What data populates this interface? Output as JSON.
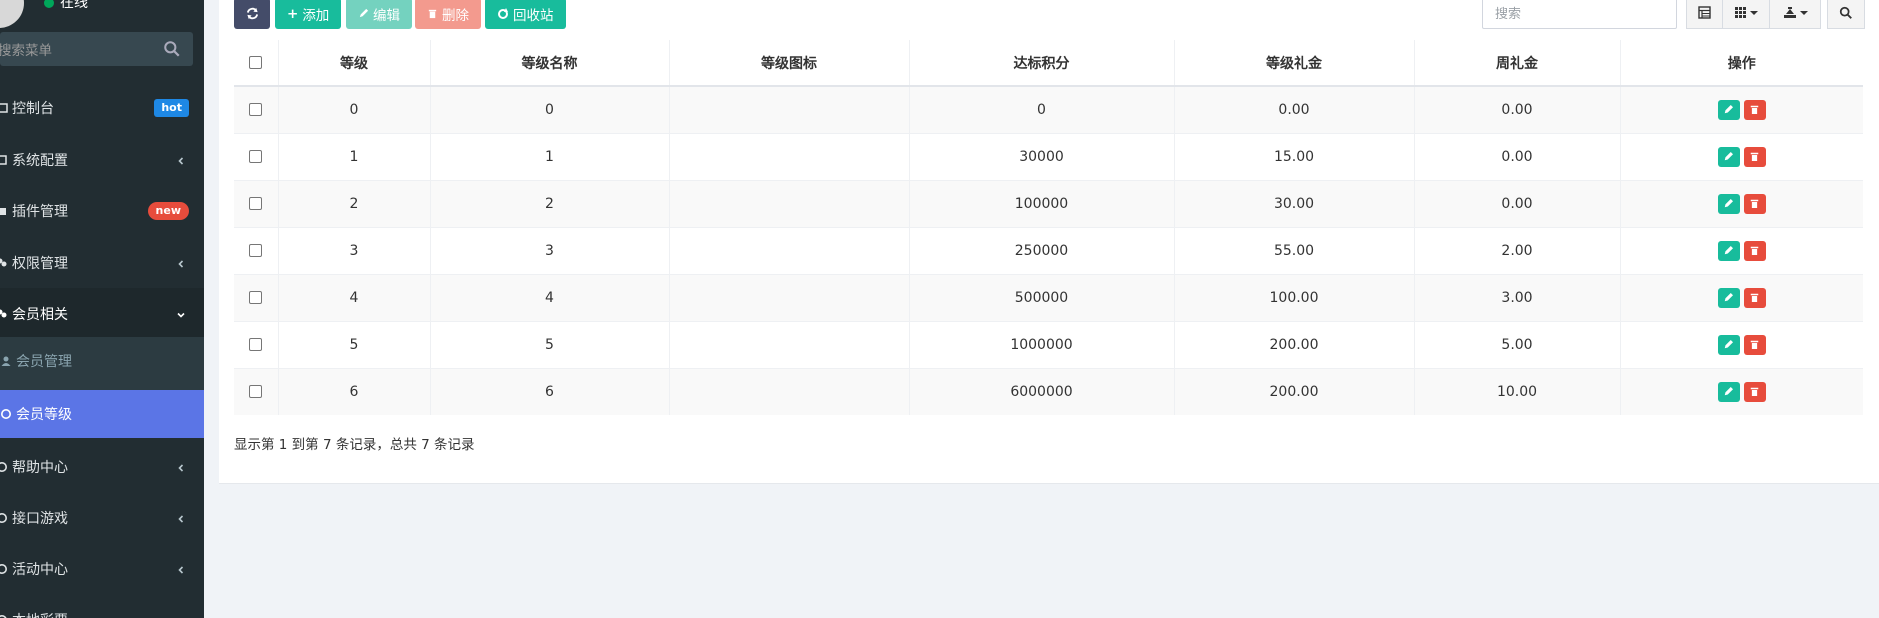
{
  "user": {
    "status": "在线"
  },
  "sidebar": {
    "search_placeholder": "搜索菜单",
    "items": [
      {
        "label": "控制台",
        "badge": "hot"
      },
      {
        "label": "系统配置"
      },
      {
        "label": "插件管理",
        "badge": "new"
      },
      {
        "label": "权限管理"
      },
      {
        "label": "会员相关"
      },
      {
        "label": "帮助中心"
      },
      {
        "label": "接口游戏"
      },
      {
        "label": "活动中心"
      },
      {
        "label": "本地彩票"
      }
    ],
    "submenu": [
      {
        "label": "会员管理"
      },
      {
        "label": "会员等级"
      }
    ]
  },
  "toolbar": {
    "add": "添加",
    "edit": "编辑",
    "delete": "删除",
    "recycle": "回收站",
    "search_placeholder": "搜索"
  },
  "table": {
    "columns": [
      "等级",
      "等级名称",
      "等级图标",
      "达标积分",
      "等级礼金",
      "周礼金",
      "操作"
    ],
    "rows": [
      {
        "level": "0",
        "name": "0",
        "icon": "",
        "points": "0",
        "gift": "0.00",
        "weekly": "0.00"
      },
      {
        "level": "1",
        "name": "1",
        "icon": "",
        "points": "30000",
        "gift": "15.00",
        "weekly": "0.00"
      },
      {
        "level": "2",
        "name": "2",
        "icon": "",
        "points": "100000",
        "gift": "30.00",
        "weekly": "0.00"
      },
      {
        "level": "3",
        "name": "3",
        "icon": "",
        "points": "250000",
        "gift": "55.00",
        "weekly": "2.00"
      },
      {
        "level": "4",
        "name": "4",
        "icon": "",
        "points": "500000",
        "gift": "100.00",
        "weekly": "3.00"
      },
      {
        "level": "5",
        "name": "5",
        "icon": "",
        "points": "1000000",
        "gift": "200.00",
        "weekly": "5.00"
      },
      {
        "level": "6",
        "name": "6",
        "icon": "",
        "points": "6000000",
        "gift": "200.00",
        "weekly": "10.00"
      }
    ]
  },
  "pagination": {
    "info": "显示第 1 到第 7 条记录，总共 7 条记录"
  }
}
